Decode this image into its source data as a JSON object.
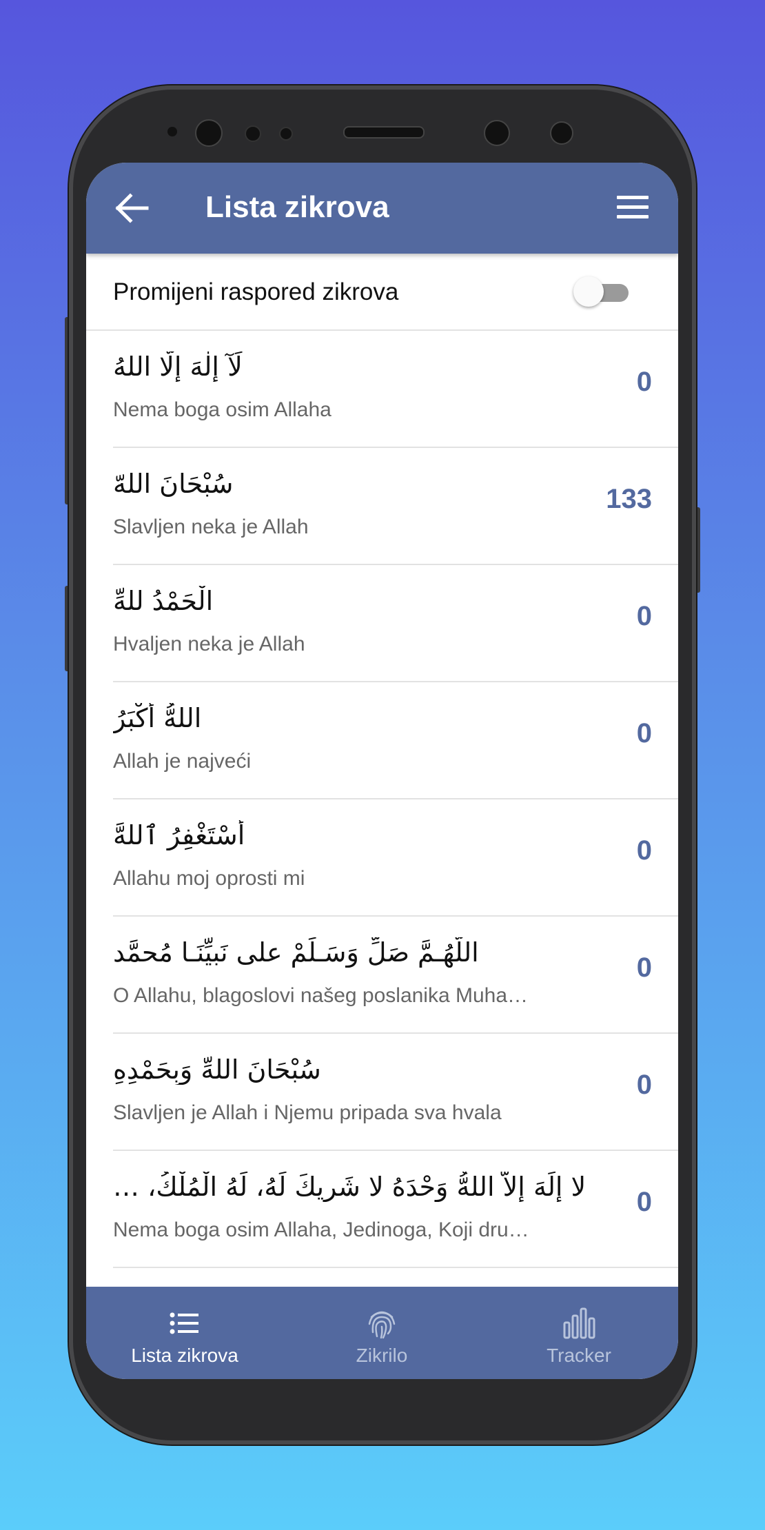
{
  "app_bar": {
    "title": "Lista zikrova",
    "back_icon": "arrow-left-icon",
    "menu_icon": "menu-icon"
  },
  "toggle": {
    "label": "Promijeni raspored zikrova",
    "on": false
  },
  "items": [
    {
      "arabic": "لَآ إِلٰهَ إِلّا اللهُ",
      "translation": "Nema boga osim Allaha",
      "count": "0"
    },
    {
      "arabic": "سُبْحَانَ اللهّ",
      "translation": "Slavljen neka je Allah",
      "count": "133"
    },
    {
      "arabic": "الْحَمْدُ للهِّ",
      "translation": "Hvaljen neka je Allah",
      "count": "0"
    },
    {
      "arabic": "اللهُّ أَكْبَرُ",
      "translation": "Allah je najveći",
      "count": "0"
    },
    {
      "arabic": "أَسْتَغْفِرُ ٱللهَّ",
      "translation": "Allahu moj oprosti mi",
      "count": "0"
    },
    {
      "arabic": "اللّهُـمَّ صَلِّ وَسَـلِّمْ على نَبيِّنَـا مُحمَّد",
      "translation": "O Allahu, blagoslovi našeg poslanika Muha…",
      "count": "0"
    },
    {
      "arabic": "سُبْحَانَ اللهِّ وَبِحَمْدِهِ",
      "translation": "Slavljen je Allah i Njemu pripada sva hvala",
      "count": "0"
    },
    {
      "arabic": "لا إِلَهَ إِلاّ اللهُّ وَحْدَهُ لا شَرِيكَ لَهُ، لَهُ الْمُلْكُ، …",
      "translation": "Nema boga osim Allaha, Jedinoga, Koji dru…",
      "count": "0"
    }
  ],
  "bottom_nav": [
    {
      "label": "Lista zikrova",
      "icon": "list-icon",
      "active": true
    },
    {
      "label": "Zikrilo",
      "icon": "fingerprint-icon",
      "active": false
    },
    {
      "label": "Tracker",
      "icon": "bar-chart-icon",
      "active": false
    }
  ],
  "colors": {
    "accent": "#53699f",
    "background_top": "#5656dd",
    "background_bottom": "#5bcdfa"
  }
}
